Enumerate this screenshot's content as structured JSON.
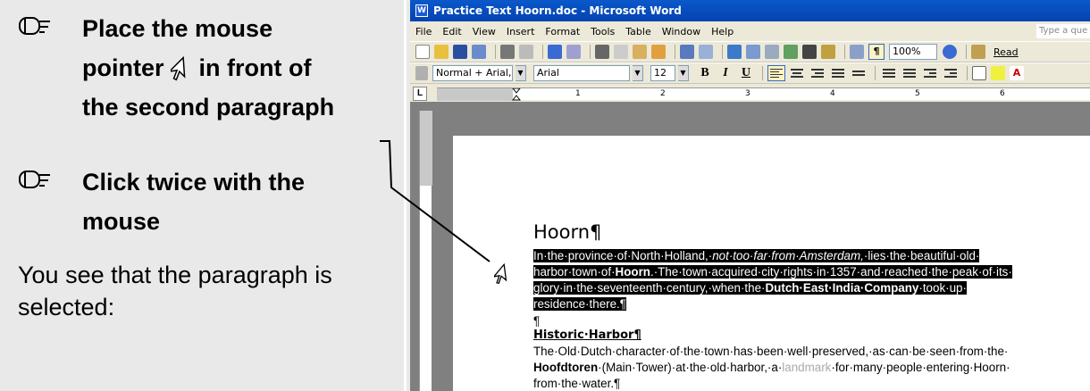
{
  "instructions": {
    "step1_line1": "Place the mouse",
    "step1_line2a": "pointer",
    "step1_line2b": "in front of",
    "step1_line3": "the second paragraph",
    "step2_line1": "Click twice with the",
    "step2_line2": "mouse",
    "result_line1": "You see that the paragraph is",
    "result_line2": "selected:"
  },
  "window": {
    "title": "Practice Text Hoorn.doc - Microsoft Word",
    "menu": [
      "File",
      "Edit",
      "View",
      "Insert",
      "Format",
      "Tools",
      "Table",
      "Window",
      "Help"
    ],
    "help_placeholder": "Type a que"
  },
  "toolbar": {
    "zoom": "100%",
    "read_label": "Read",
    "style": "Normal + Arial,",
    "font": "Arial",
    "size": "12",
    "bold": "B",
    "italic": "I",
    "underline": "U"
  },
  "ruler": {
    "numbers": [
      "1",
      "2",
      "3",
      "4",
      "5",
      "6"
    ]
  },
  "document": {
    "heading": "Hoorn¶",
    "para1": {
      "line1a": "In·the·province·of·North·Holland,·",
      "line1b": "not·too·far·from·Amsterdam,",
      "line1c": "·lies·the·beautiful·old·",
      "line2a": "harbor·town·of·",
      "line2b": "Hoorn",
      "line2c": ".·The·town·acquired·city·rights·in·1357·and·reached·the·peak·of·its·",
      "line3a": "glory·in·the·seventeenth·century,·when·the·",
      "line3b": "Dutch·East·India·Company",
      "line3c": "·took·up·",
      "line4": "residence·there.¶"
    },
    "empty_para": "¶",
    "subheading": "Historic·Harbor¶",
    "para2": {
      "line1": "The·Old·Dutch·character·of·the·town·has·been·well·preserved,·as·can·be·seen·from·the·",
      "line2a": "Hoofdtoren",
      "line2b": "·(Main·Tower)·at·the·old·harbor,·a·",
      "line2c": "landmark",
      "line2d": "·for·many·people·entering·Hoorn·",
      "line3": "from·the·water.¶"
    }
  }
}
